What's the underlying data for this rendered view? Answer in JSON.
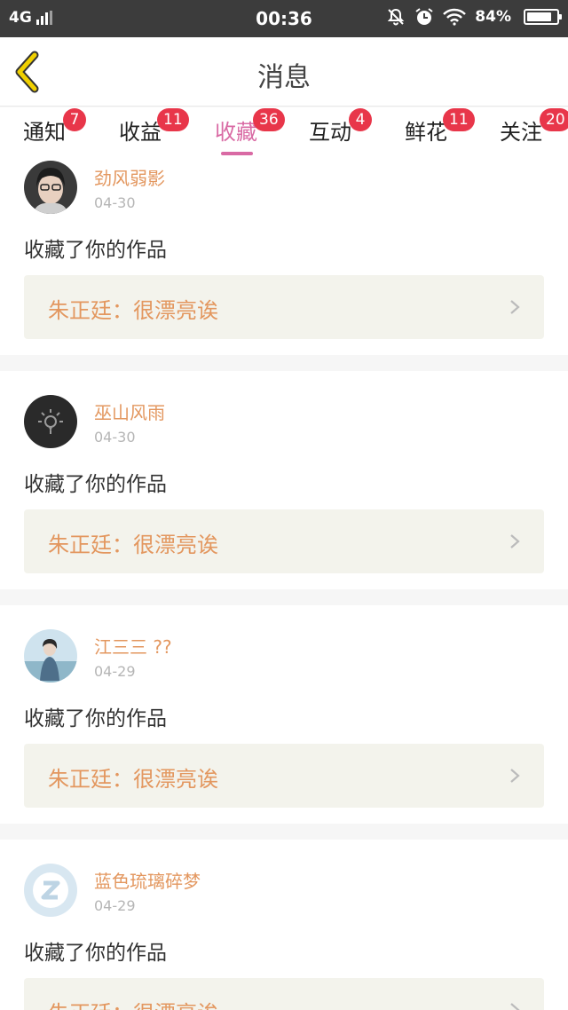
{
  "status_bar": {
    "network": "4G",
    "time": "00:36",
    "battery": "84%",
    "battery_level": 0.84
  },
  "header": {
    "title": "消息",
    "back_icon": "chevron-left-icon",
    "accent_color": "#f0d000"
  },
  "tabs": [
    {
      "label": "通知",
      "badge": "7"
    },
    {
      "label": "收益",
      "badge": "11"
    },
    {
      "label": "收藏",
      "badge": "36",
      "active": true
    },
    {
      "label": "互动",
      "badge": "4"
    },
    {
      "label": "鲜花",
      "badge": "11"
    },
    {
      "label": "关注",
      "badge": "20"
    }
  ],
  "colors": {
    "active_tab": "#d96aa4",
    "badge": "#e8364a",
    "username": "#e3975f",
    "quote_bg": "#f3f3ec"
  },
  "messages": [
    {
      "user": "劲风弱影",
      "date": "04-30",
      "action": "收藏了你的作品",
      "quote": "朱正廷：很漂亮诶"
    },
    {
      "user": "巫山风雨",
      "date": "04-30",
      "action": "收藏了你的作品",
      "quote": "朱正廷：很漂亮诶"
    },
    {
      "user": "江三三 ??",
      "date": "04-29",
      "action": "收藏了你的作品",
      "quote": "朱正廷：很漂亮诶"
    },
    {
      "user": "蓝色琉璃碎梦",
      "date": "04-29",
      "action": "收藏了你的作品",
      "quote": "朱正廷：很漂亮诶"
    }
  ]
}
